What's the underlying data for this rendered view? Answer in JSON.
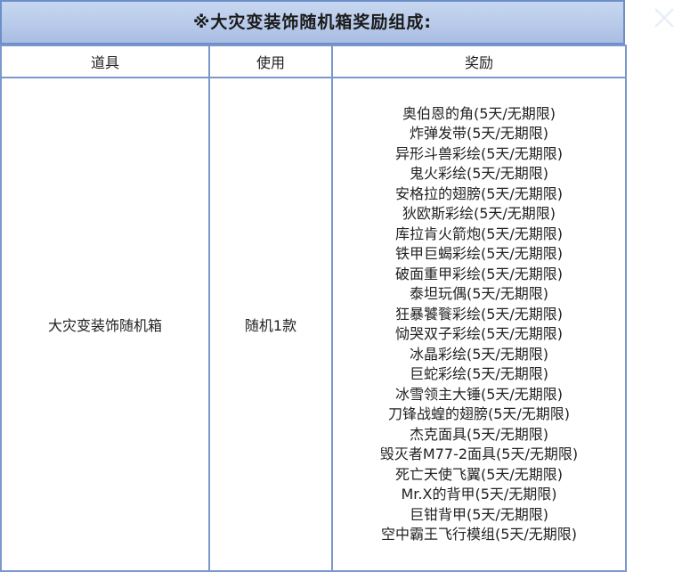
{
  "title": "※大灾变装饰随机箱奖励组成:",
  "columns": [
    "道具",
    "使用",
    "奖励"
  ],
  "row": {
    "item": "大灾变装饰随机箱",
    "usage": "随机1款",
    "rewards": [
      "奥伯恩的角(5天/无期限)",
      "炸弹发带(5天/无期限)",
      "异形斗兽彩绘(5天/无期限)",
      "鬼火彩绘(5天/无期限)",
      "安格拉的翅膀(5天/无期限)",
      "狄欧斯彩绘(5天/无期限)",
      "库拉肯火箭炮(5天/无期限)",
      "铁甲巨蝎彩绘(5天/无期限)",
      "破面重甲彩绘(5天/无期限)",
      "泰坦玩偶(5天/无期限)",
      "狂暴饕餮彩绘(5天/无期限)",
      "恸哭双子彩绘(5天/无期限)",
      "冰晶彩绘(5天/无期限)",
      "巨蛇彩绘(5天/无期限)",
      "冰雪领主大锤(5天/无期限)",
      "刀锋战蝗的翅膀(5天/无期限)",
      "杰克面具(5天/无期限)",
      "毁灭者M77-2面具(5天/无期限)",
      "死亡天使飞翼(5天/无期限)",
      "Mr.X的背甲(5天/无期限)",
      "巨钳背甲(5天/无期限)",
      "空中霸王飞行模组(5天/无期限)"
    ]
  },
  "colors": {
    "title_bg": "#b7c9e9",
    "border": "#7b98cc",
    "text": "#222222"
  },
  "icons": {
    "close": "close-icon"
  }
}
